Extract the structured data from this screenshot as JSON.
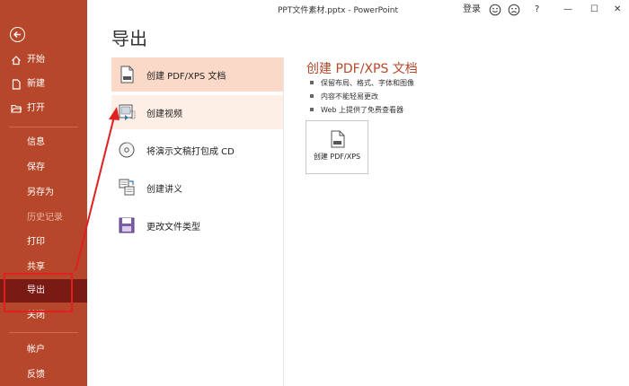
{
  "window": {
    "title": "PPT文件素材.pptx  -  PowerPoint",
    "login_label": "登录",
    "help_label": "?",
    "minimize_label": "—",
    "maximize_label": "☐",
    "close_label": "✕"
  },
  "sidebar": {
    "items": [
      {
        "label": "开始",
        "icon": "home-icon"
      },
      {
        "label": "新建",
        "icon": "new-doc-icon"
      },
      {
        "label": "打开",
        "icon": "folder-open-icon"
      },
      {
        "label": "信息"
      },
      {
        "label": "保存"
      },
      {
        "label": "另存为"
      },
      {
        "label": "历史记录",
        "disabled": true
      },
      {
        "label": "打印"
      },
      {
        "label": "共享"
      },
      {
        "label": "导出",
        "active": true
      },
      {
        "label": "关闭"
      },
      {
        "label": "帐户"
      },
      {
        "label": "反馈"
      }
    ]
  },
  "main": {
    "heading": "导出",
    "options": [
      {
        "label": "创建 PDF/XPS 文档",
        "icon": "pdf-document-icon",
        "selected": true
      },
      {
        "label": "创建视频",
        "icon": "video-icon"
      },
      {
        "label": "将演示文稿打包成 CD",
        "icon": "cd-icon"
      },
      {
        "label": "创建讲义",
        "icon": "handout-icon"
      },
      {
        "label": "更改文件类型",
        "icon": "file-type-icon"
      }
    ]
  },
  "detail": {
    "title": "创建 PDF/XPS 文档",
    "bullets": [
      "保留布局、格式、字体和图像",
      "内容不能轻易更改",
      "Web 上提供了免费查看器"
    ],
    "button_label": "创建 PDF/XPS"
  },
  "colors": {
    "accent": "#b7472a",
    "sidebar_active": "#7a1a15",
    "selected_option": "#fbd9c8",
    "annotation": "#e02020"
  }
}
